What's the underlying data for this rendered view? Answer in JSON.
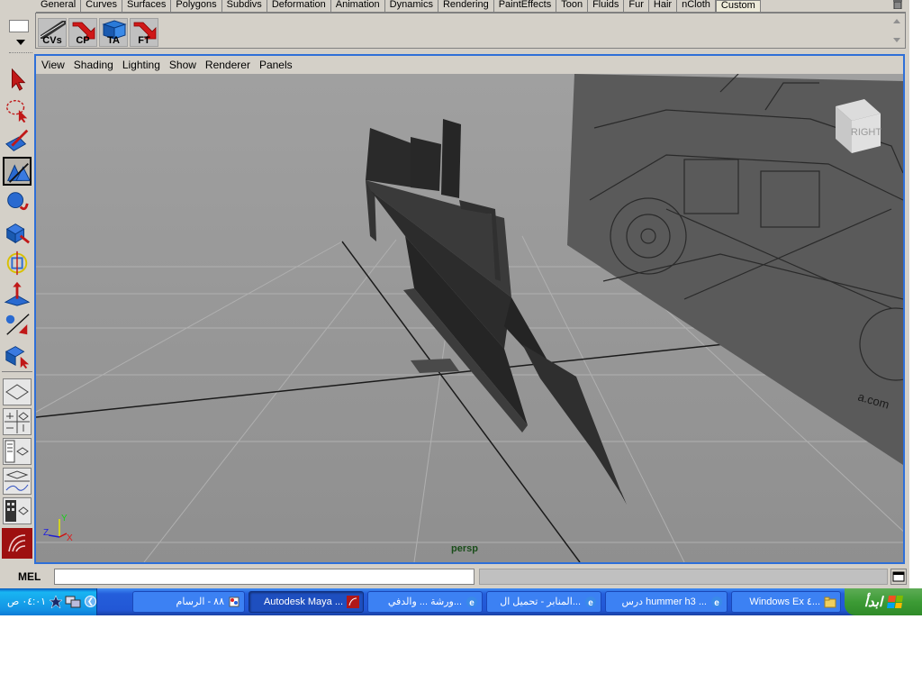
{
  "shelf_tabs": [
    "General",
    "Curves",
    "Surfaces",
    "Polygons",
    "Subdivs",
    "Deformation",
    "Animation",
    "Dynamics",
    "Rendering",
    "PaintEffects",
    "Toon",
    "Fluids",
    "Fur",
    "Hair",
    "nCloth",
    "Custom"
  ],
  "active_shelf_tab": "Custom",
  "shelf_buttons": [
    {
      "label": "CVs",
      "icon": "show-cvs-icon"
    },
    {
      "label": "CP",
      "icon": "red-arrow-icon"
    },
    {
      "label": "TA",
      "icon": "toggle-attributes-icon"
    },
    {
      "label": "FT",
      "icon": "red-arrow-icon"
    }
  ],
  "tools": [
    {
      "name": "select-tool",
      "icon": "arrow-cursor-icon"
    },
    {
      "name": "lasso-tool",
      "icon": "lasso-icon"
    },
    {
      "name": "paint-select-tool",
      "icon": "paint-brush-icon"
    },
    {
      "name": "move-tool",
      "icon": "move-icon",
      "active": true
    },
    {
      "name": "rotate-tool",
      "icon": "rotate-icon"
    },
    {
      "name": "scale-tool",
      "icon": "scale-icon"
    },
    {
      "name": "universal-manipulator",
      "icon": "universal-manipulator-icon"
    },
    {
      "name": "soft-modification-tool",
      "icon": "soft-mod-icon"
    },
    {
      "name": "show-manipulator-tool",
      "icon": "manipulator-icon"
    },
    {
      "name": "last-tool-used",
      "icon": "last-tool-icon"
    }
  ],
  "panel_menu": [
    "View",
    "Shading",
    "Lighting",
    "Show",
    "Renderer",
    "Panels"
  ],
  "viewport": {
    "camera_label": "persp",
    "view_cube_label": "RIGHT",
    "axis_labels": {
      "x": "X",
      "y": "Y",
      "z": "Z"
    },
    "image_plane_text": "a.com"
  },
  "command_line": {
    "language_label": "MEL",
    "value": ""
  },
  "taskbar": {
    "start_label": "ابدأ",
    "clock": "٠٤:٠١ ص",
    "tasks": [
      {
        "label": "Windows Ex ٤...",
        "icon": "folder-icon"
      },
      {
        "label": "درس hummer h3 ...",
        "icon": "ie-icon"
      },
      {
        "label": "المنابر - تحميل ال...",
        "icon": "ie-icon"
      },
      {
        "label": "ورشة ... والدفي...",
        "icon": "ie-icon"
      },
      {
        "label": "Autodesk Maya ...",
        "icon": "maya-icon",
        "active": true
      },
      {
        "label": "٨٨ - الرسام",
        "icon": "paint-icon"
      }
    ]
  },
  "colors": {
    "panel_border": "#2e6fd8",
    "viewport_bg": "#9a9a9a",
    "model": "#2a2a2a",
    "taskbar": "#245edb",
    "start_button": "#3c9b35"
  }
}
